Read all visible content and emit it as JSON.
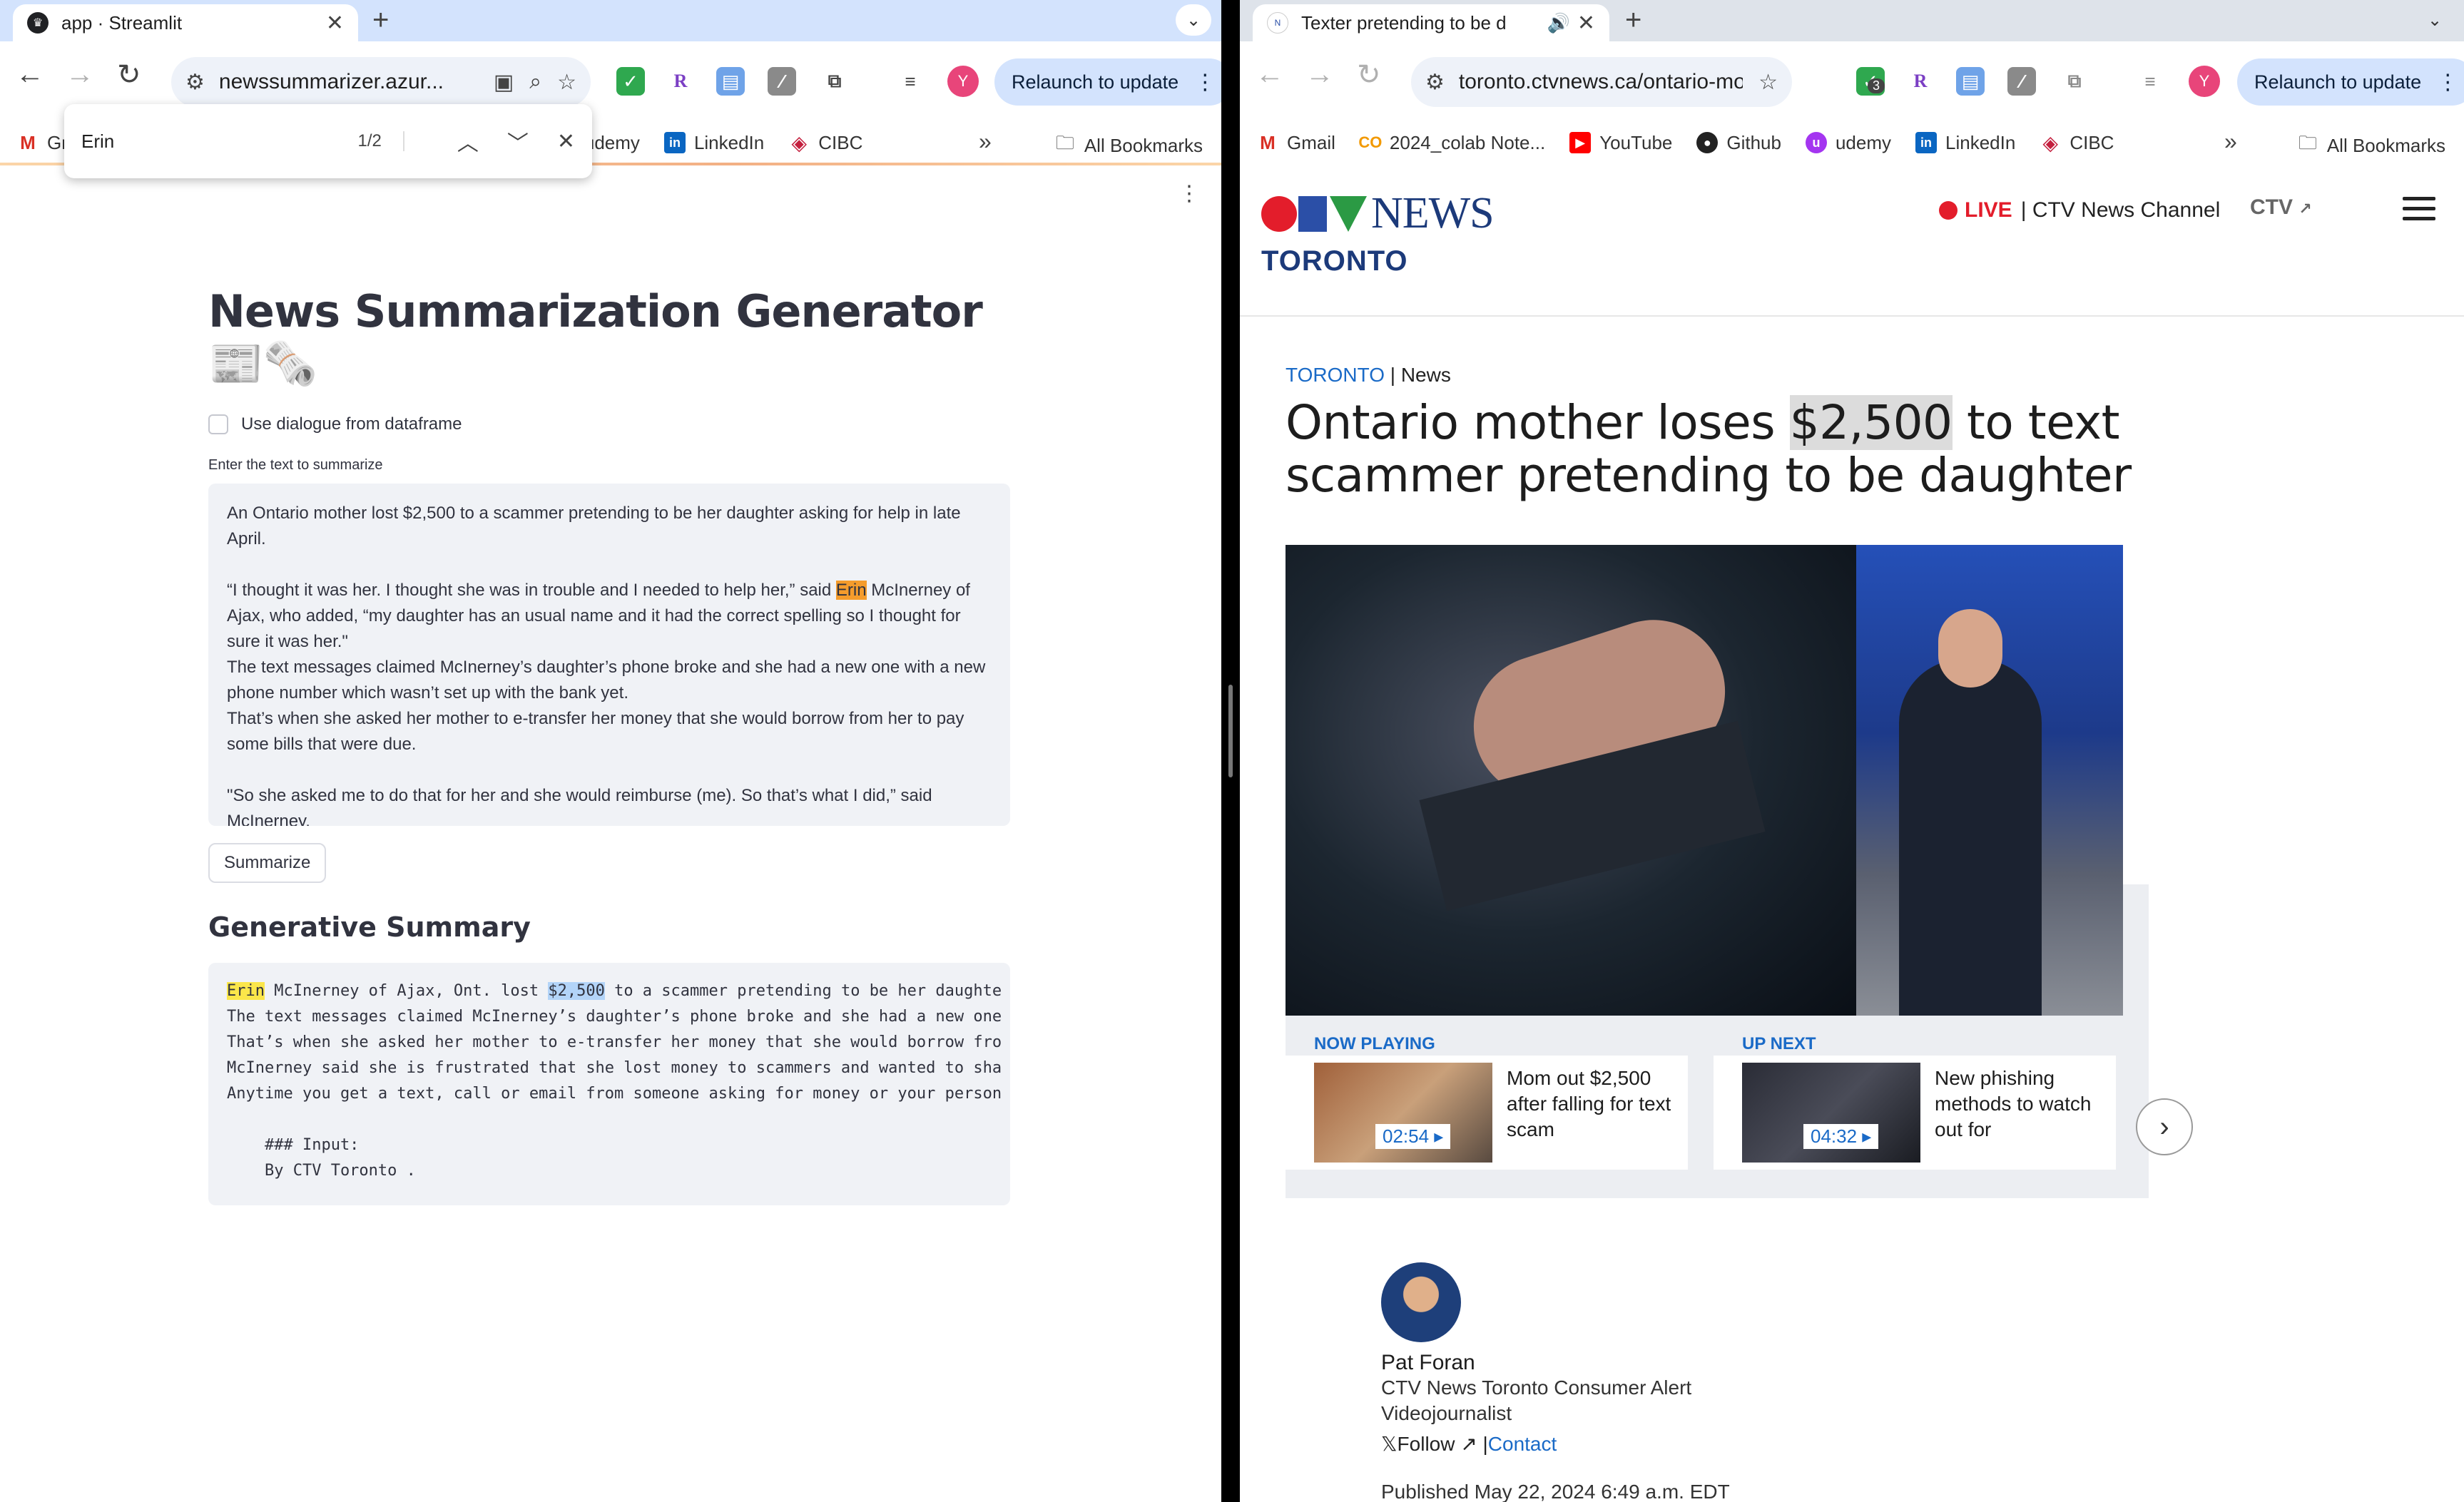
{
  "left": {
    "tab_title": "app · Streamlit",
    "url": "newssummarizer.azur...",
    "relaunch": "Relaunch to update",
    "avatar": "Y",
    "bookmarks": [
      "Gr",
      "udemy",
      "LinkedIn",
      "CIBC"
    ],
    "all_bookmarks": "All Bookmarks",
    "find": {
      "query": "Erin",
      "count": "1/2"
    },
    "app": {
      "title": "News Summarization Generator 📰🗞️",
      "checkbox_label": "Use dialogue from dataframe",
      "input_label": "Enter the text to summarize",
      "text_p1": "An Ontario mother lost $2,500 to a scammer pretending to be her daughter asking for help in late April.",
      "text_p2a": "“I thought it was her. I thought she was in trouble and I needed to help her,” said ",
      "text_p2_hl": "Erin",
      "text_p2b": " McInerney of Ajax, who added, “my daughter has an usual name and it had the correct spelling so I thought for sure it was her.\"",
      "text_p3": "The text messages claimed McInerney’s daughter’s phone broke and she had a new one with a new phone number which wasn’t set up with the bank yet.",
      "text_p4": "That’s when she asked her mother to e-transfer her money that she would borrow from her to pay some bills that were due.",
      "text_p5": "\"So she asked me to do that for her and she would reimburse (me). So that’s what I did,” said McInerney.",
      "button": "Summarize",
      "summary_heading": "Generative Summary",
      "summary_l1_hl1": "Erin",
      "summary_l1a": " McInerney of Ajax, Ont. lost ",
      "summary_l1_hl2": "$2,500",
      "summary_l1b": " to a scammer pretending to be her daughte",
      "summary_l2": "The text messages claimed McInerney’s daughter’s phone broke and she had a new one",
      "summary_l3": "That’s when she asked her mother to e-transfer her money that she would borrow fro",
      "summary_l4": "McInerney said she is frustrated that she lost money to scammers and wanted to sha",
      "summary_l5": "Anytime you get a text, call or email from someone asking for money or your person",
      "summary_l6": "    ### Input:",
      "summary_l7": "    By CTV Toronto ."
    }
  },
  "right": {
    "tab_title": "Texter pretending to be d",
    "url": "toronto.ctvnews.ca/ontario-mot...",
    "relaunch": "Relaunch to update",
    "avatar": "Y",
    "ext_badge": "3",
    "bookmarks": [
      "Gmail",
      "2024_colab Note...",
      "YouTube",
      "Github",
      "udemy",
      "LinkedIn",
      "CIBC"
    ],
    "all_bookmarks": "All Bookmarks",
    "site": {
      "news": "NEWS",
      "city": "TORONTO",
      "live": "LIVE",
      "channel": "| CTV News Channel",
      "ctv_small": "CTV"
    },
    "article": {
      "crumb_city": "TORONTO",
      "crumb_section": "News",
      "headline_a": "Ontario mother loses ",
      "headline_hl": "$2,500",
      "headline_b": " to text scammer pretending to be daughter",
      "now_playing_label": "NOW PLAYING",
      "now_playing_title": "Mom out $2,500 after falling for text scam",
      "now_playing_dur": "02:54 ▸",
      "up_next_label": "UP NEXT",
      "up_next_title": "New phishing methods to watch out for",
      "up_next_dur": "04:32 ▸",
      "author_name": "Pat Foran",
      "author_role1": "CTV News Toronto Consumer Alert",
      "author_role2": "Videojournalist",
      "follow": "𝕏Follow ↗",
      "contact": "Contact",
      "published": "Published May 22, 2024 6:49 a.m. EDT"
    }
  }
}
